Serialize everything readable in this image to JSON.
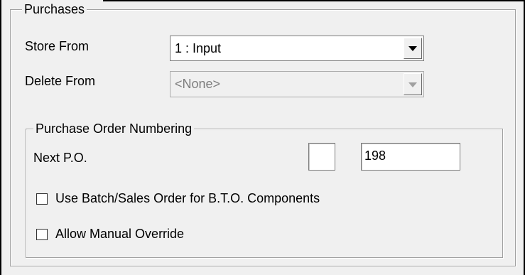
{
  "purchases": {
    "title": "Purchases",
    "store_from": {
      "label": "Store From",
      "value": "1 : Input"
    },
    "delete_from": {
      "label": "Delete From",
      "value": "<None>",
      "enabled": false
    }
  },
  "po_numbering": {
    "title": "Purchase Order Numbering",
    "next_po": {
      "label": "Next P.O.",
      "prefix_value": "",
      "number_value": "198"
    },
    "use_batch": {
      "label": "Use Batch/Sales Order for B.T.O. Components",
      "checked": false
    },
    "allow_override": {
      "label": "Allow Manual Override",
      "checked": false
    }
  }
}
